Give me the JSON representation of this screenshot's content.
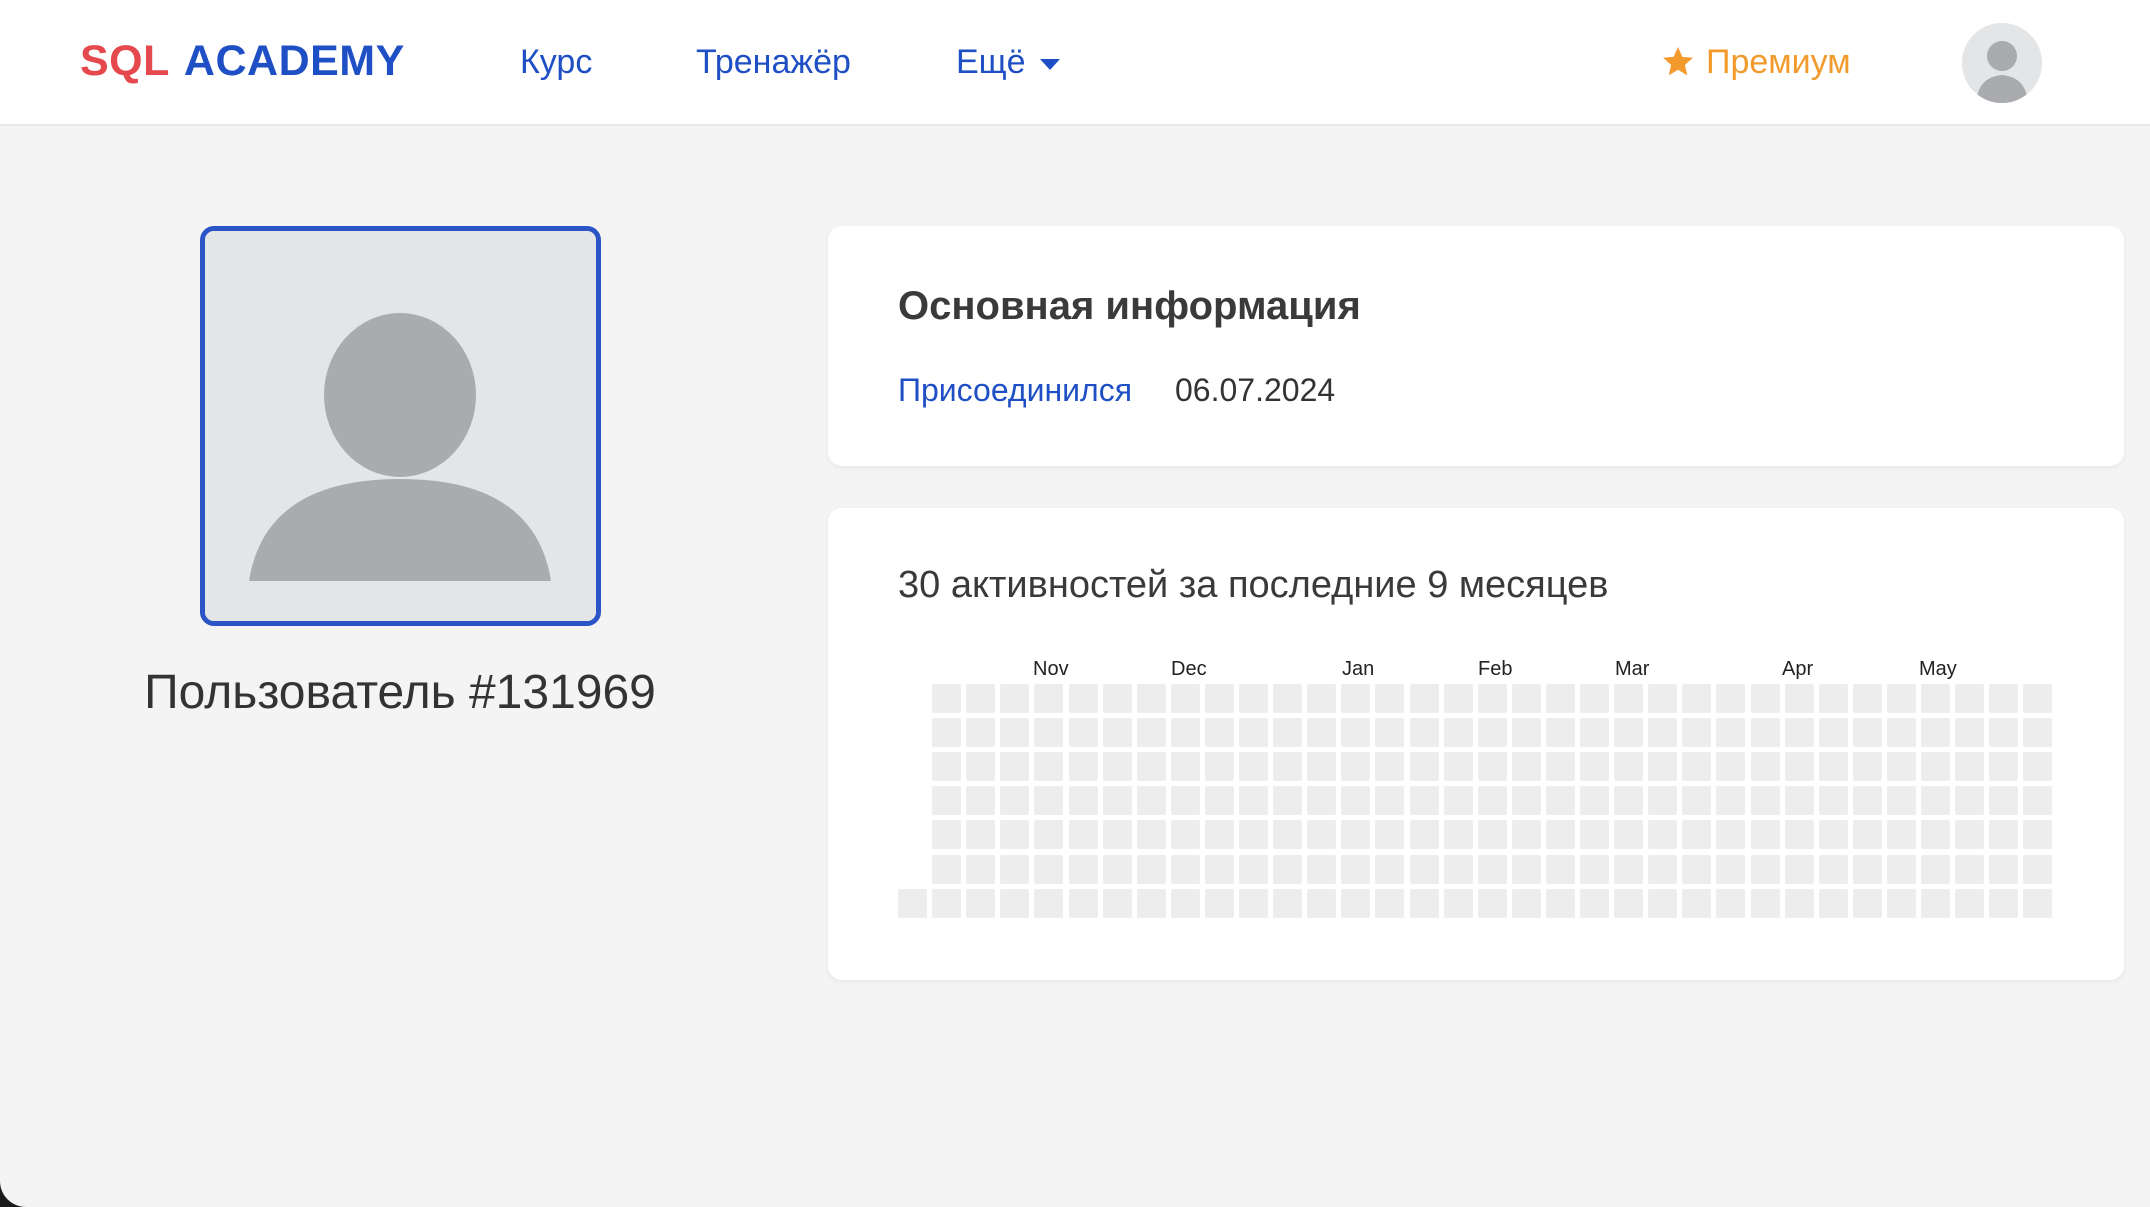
{
  "header": {
    "logo_sql": "SQL",
    "logo_academy": "ACADEMY",
    "nav": [
      {
        "label": "Курс"
      },
      {
        "label": "Тренажёр"
      },
      {
        "label": "Ещё"
      }
    ],
    "premium_label": "Премиум",
    "accent_color": "#1f4fc4",
    "premium_color": "#f39a2c"
  },
  "profile": {
    "username": "Пользователь #131969"
  },
  "info": {
    "title": "Основная информация",
    "joined_label": "Присоединился",
    "joined_value": "06.07.2024"
  },
  "activity": {
    "title": "30 активностей за последние 9 месяцев",
    "months": [
      "Nov",
      "Dec",
      "Jan",
      "Feb",
      "Mar",
      "Apr",
      "May"
    ],
    "weeks": 34,
    "days": 7,
    "empty_cell_color": "#ededed"
  }
}
